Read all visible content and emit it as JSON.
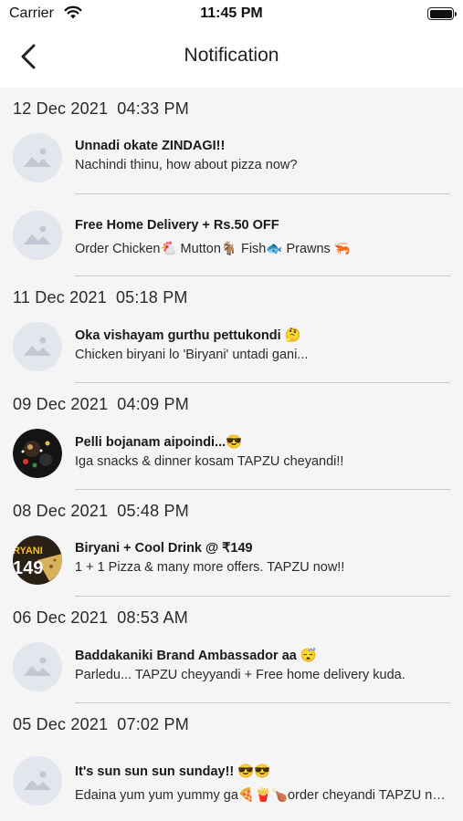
{
  "status_bar": {
    "carrier": "Carrier",
    "time": "11:45 PM"
  },
  "header": {
    "title": "Notification"
  },
  "groups": [
    {
      "date": "12 Dec 2021",
      "time": "04:33 PM",
      "items": [
        {
          "title": "Unnadi okate ZINDAGI!!",
          "body": "Nachindi thinu, how about pizza now?",
          "image": "placeholder"
        },
        {
          "title": "Free Home Delivery + Rs.50 OFF",
          "body": "Order Chicken🐔 Mutton🐐 Fish🐟 Prawns 🦐",
          "image": "placeholder"
        }
      ]
    },
    {
      "date": "11 Dec 2021",
      "time": "05:18 PM",
      "items": [
        {
          "title": "Oka vishayam gurthu pettukondi 🤔",
          "body": "Chicken biryani lo 'Biryani' untadi gani...",
          "image": "placeholder"
        }
      ]
    },
    {
      "date": "09 Dec 2021",
      "time": "04:09 PM",
      "items": [
        {
          "title": "Pelli bojanam aipoindi...😎",
          "body": "Iga snacks & dinner kosam TAPZU cheyandi!!",
          "image": "food-dark"
        }
      ]
    },
    {
      "date": "08 Dec 2021",
      "time": "05:48 PM",
      "items": [
        {
          "title": "Biryani + Cool Drink @ ₹149",
          "body": "1 + 1 Pizza & many more offers. TAPZU now!!",
          "image": "biryani-149",
          "badge_text": "RYANI",
          "badge_price": "149"
        }
      ]
    },
    {
      "date": "06 Dec 2021",
      "time": "08:53 AM",
      "items": [
        {
          "title": "Baddakaniki Brand Ambassador aa 😴",
          "body": "Parledu... TAPZU cheyyandi + Free home delivery kuda.",
          "image": "placeholder"
        }
      ]
    },
    {
      "date": "05 Dec 2021",
      "time": "07:02 PM",
      "items": [
        {
          "title": "It's sun sun sun sunday!! 😎😎",
          "body": "Edaina yum yum yummy ga🍕🍟🍗order cheyandi TAPZU now!!",
          "image": "placeholder"
        }
      ]
    }
  ]
}
